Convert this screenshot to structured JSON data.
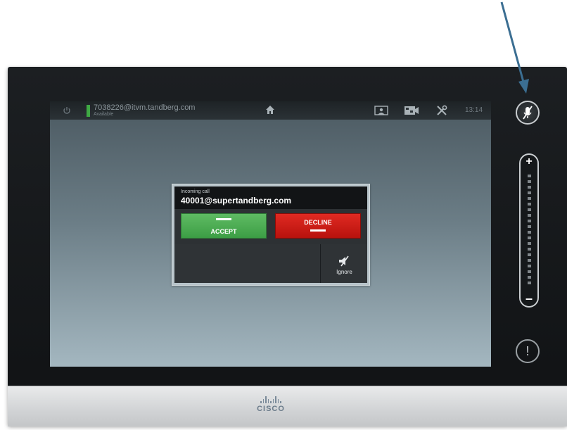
{
  "status_bar": {
    "address": "7038226@itvm.tandberg.com",
    "availability": "Available",
    "time": "13:14"
  },
  "call_dialog": {
    "label": "Incoming call",
    "caller": "40001@supertandberg.com",
    "accept_label": "ACCEPT",
    "decline_label": "DECLINE",
    "ignore_label": "Ignore"
  },
  "side_panel": {
    "volume_plus": "+",
    "volume_minus": "–",
    "alert_symbol": "!"
  },
  "brand": {
    "logo_text": "CISCO"
  },
  "icons": [
    "power-icon",
    "home-icon",
    "selfview-icon",
    "camera-icon",
    "settings-icon",
    "mute-microphone-icon",
    "ignore-speaker-icon",
    "annotation-arrow-icon"
  ],
  "colors": {
    "accept": "#3c9e45",
    "decline": "#c4160f",
    "status_available": "#3fa944",
    "arrow": "#3b6e92"
  }
}
